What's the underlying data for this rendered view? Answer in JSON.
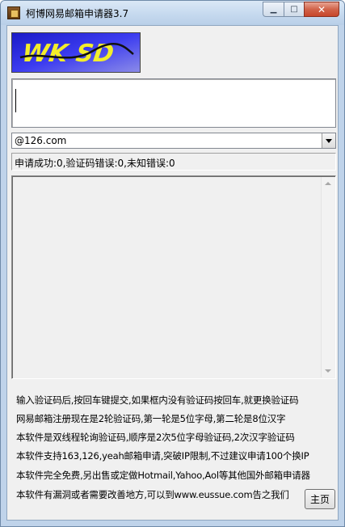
{
  "window": {
    "title": "柯博网易邮箱申请器3.7",
    "buttons": {
      "minimize": "▁",
      "maximize": "□",
      "close": "✕"
    }
  },
  "captcha": {
    "text": "WK SD",
    "icon": "captcha-image"
  },
  "code_input": {
    "value": ""
  },
  "domain_select": {
    "value": "@126.com"
  },
  "status": {
    "text": "申请成功:0,验证码错误:0,未知错误:0"
  },
  "log": {
    "content": ""
  },
  "info_lines": [
    "输入验证码后,按回车键提交,如果框内没有验证码按回车,就更换验证码",
    "网易邮箱注册现在是2轮验证码,第一轮是5位字母,第二轮是8位汉字",
    "本软件是双线程轮询验证码,顺序是2次5位字母验证码,2次汉字验证码",
    "本软件支持163,126,yeah邮箱申请,突破IP限制,不过建议申请100个换IP",
    "本软件完全免费,另出售或定做Hotmail,Yahoo,Aol等其他国外邮箱申请器",
    "本软件有漏洞或者需要改善地方,可以到www.eussue.com告之我们"
  ],
  "home_button": {
    "label": "主页"
  },
  "colors": {
    "titlebar": "#c4d8ee",
    "close_button": "#c7462b",
    "client_bg": "#f0f0f0",
    "captcha_bg": "#1a1ac8",
    "captcha_text": "#f3ee2a"
  }
}
